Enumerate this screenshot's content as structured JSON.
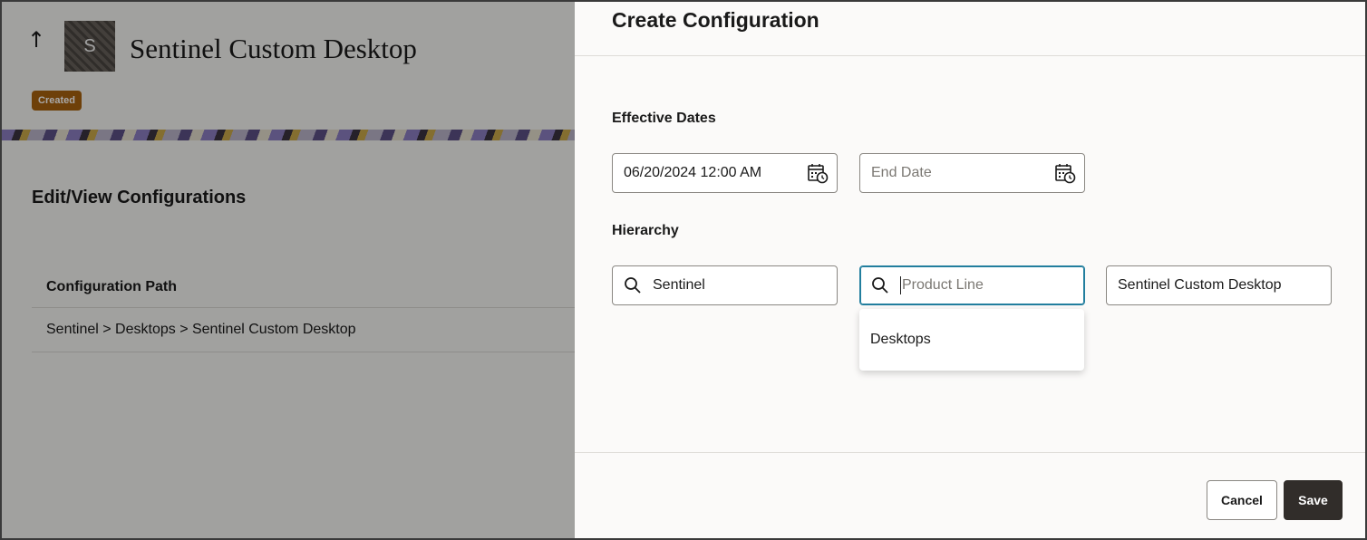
{
  "background_page": {
    "back_icon": "up-arrow-icon",
    "avatar_letter": "S",
    "title": "Sentinel Custom Desktop",
    "status_badge": "Created",
    "section_heading": "Edit/View Configurations",
    "table": {
      "column_header": "Configuration Path",
      "rows": [
        "Sentinel > Desktops > Sentinel Custom Desktop"
      ]
    }
  },
  "drawer": {
    "title": "Create Configuration",
    "effective_dates": {
      "label": "Effective Dates",
      "start_date_value": "06/20/2024 12:00 AM",
      "end_date_placeholder": "End Date",
      "icon": "calendar-clock-icon"
    },
    "hierarchy": {
      "label": "Hierarchy",
      "product_family_value": "Sentinel",
      "product_line_placeholder": "Product Line",
      "product_value": "Sentinel Custom Desktop",
      "search_icon": "search-icon",
      "dropdown_options": [
        "Desktops"
      ]
    },
    "footer": {
      "cancel_label": "Cancel",
      "save_label": "Save"
    }
  },
  "colors": {
    "badge": "#a8620f",
    "focus_border": "#227e9e",
    "primary_button": "#312d2a",
    "drawer_background": "#fbfaf9"
  }
}
